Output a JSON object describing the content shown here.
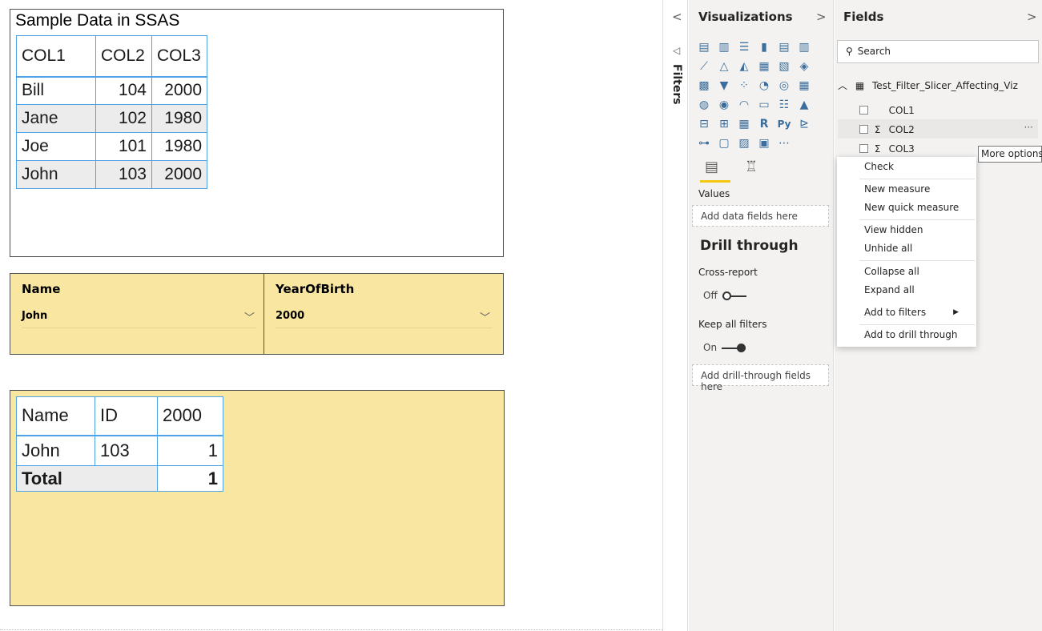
{
  "visual1": {
    "title": "Sample Data in SSAS",
    "headers": [
      "COL1",
      "COL2",
      "COL3"
    ],
    "rows": [
      [
        "Bill",
        "104",
        "2000"
      ],
      [
        "Jane",
        "102",
        "1980"
      ],
      [
        "Joe",
        "101",
        "1980"
      ],
      [
        "John",
        "103",
        "2000"
      ]
    ]
  },
  "slicer_name": {
    "label": "Name",
    "value": "John"
  },
  "slicer_year": {
    "label": "YearOfBirth",
    "value": "2000"
  },
  "visual3": {
    "headers": [
      "Name",
      "ID",
      "2000"
    ],
    "row": [
      "John",
      "103",
      "1"
    ],
    "total_label": "Total",
    "total_value": "1"
  },
  "filters_strip": {
    "label": "Filters"
  },
  "visualizations": {
    "title": "Visualizations",
    "values_label": "Values",
    "values_placeholder": "Add data fields here",
    "drill_title": "Drill through",
    "cross_report_label": "Cross-report",
    "cross_report_state": "Off",
    "keep_filters_label": "Keep all filters",
    "keep_filters_state": "On",
    "drill_placeholder": "Add drill-through fields here"
  },
  "fields": {
    "title": "Fields",
    "search_placeholder": "Search",
    "table_name": "Test_Filter_Slicer_Affecting_Viz",
    "items": [
      {
        "name": "COL1",
        "sigma": ""
      },
      {
        "name": "COL2",
        "sigma": "Σ"
      },
      {
        "name": "COL3",
        "sigma": "Σ"
      }
    ],
    "row_more": "···"
  },
  "tooltip": "More options",
  "context_menu": [
    "Check",
    "New measure",
    "New quick measure",
    "View hidden",
    "Unhide all",
    "Collapse all",
    "Expand all",
    "Add to filters",
    "Add to drill through"
  ],
  "colors": {
    "accent_yellow": "#f2c811",
    "slicer_bg": "#f9e6a0",
    "table_border": "#4ea3e8",
    "pane_bg": "#f3f2f1"
  }
}
